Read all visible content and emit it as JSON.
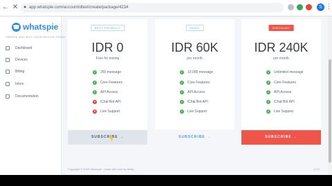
{
  "browser": {
    "url": "app.whatspie.com/account/dtext/create/package/4234",
    "avatar_letter": "S"
  },
  "sidebar": {
    "brand": "whatspie",
    "caption": "CREATE AND BUY YOUR DEVICE TODAY",
    "items": [
      {
        "label": "Dashboard"
      },
      {
        "label": "Devices"
      },
      {
        "label": "Billing"
      },
      {
        "label": "Inbox"
      },
      {
        "label": "Documentation"
      }
    ]
  },
  "plans": [
    {
      "badge": "BEST PRODUCT",
      "price": "IDR 0",
      "subtitle": "Free for testing",
      "features": [
        {
          "label": "250 message",
          "on": true
        },
        {
          "label": "Core Features",
          "on": true
        },
        {
          "label": "API Access",
          "on": true
        },
        {
          "label": "iChat Bot API",
          "on": false
        },
        {
          "label": "Live Support",
          "on": false
        }
      ],
      "button": "SUBSCRIBE  →"
    },
    {
      "badge": "BASIC",
      "price": "IDR 60K",
      "subtitle": "per month",
      "features": [
        {
          "label": "10.000 message",
          "on": true
        },
        {
          "label": "Core Features",
          "on": true
        },
        {
          "label": "API Access",
          "on": true
        },
        {
          "label": "iChat Bot API",
          "on": true
        },
        {
          "label": "Live Support",
          "on": true
        }
      ],
      "button": "SUBSCRIBE  →"
    },
    {
      "badge": "DISCOUNT",
      "price": "IDR 240K",
      "subtitle": "per month",
      "features": [
        {
          "label": "Unlimited message",
          "on": true
        },
        {
          "label": "Core Features",
          "on": true
        },
        {
          "label": "API Access",
          "on": true
        },
        {
          "label": "iChat Bot API",
          "on": true
        },
        {
          "label": "Live Support",
          "on": true
        }
      ],
      "button": "SUBSCRIBE  →"
    }
  ],
  "footer": {
    "copyright": "Copyright © 2020 Whatspie · made with love by Wolfy",
    "version": "1.0.0"
  }
}
